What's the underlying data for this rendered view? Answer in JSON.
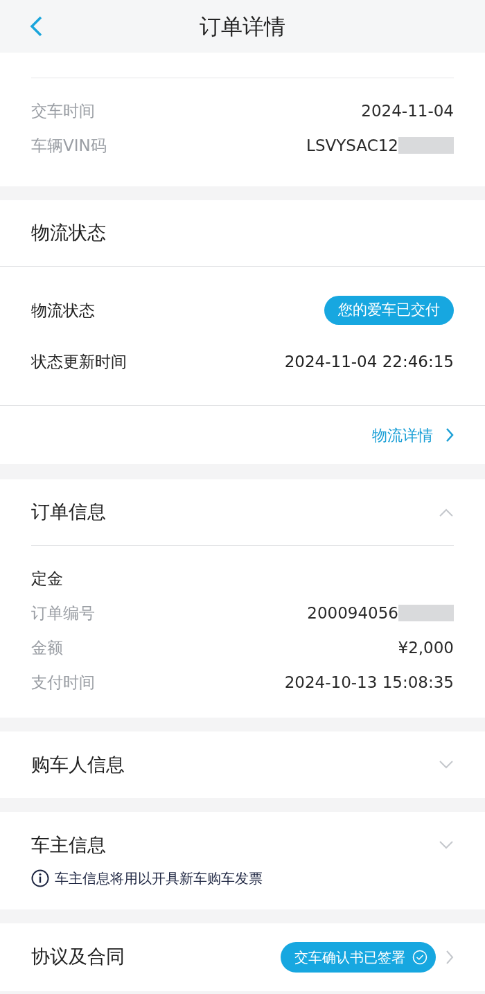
{
  "header": {
    "title": "订单详情"
  },
  "delivery": {
    "rows": [
      {
        "label": "交车时间",
        "value": "2024-11-04",
        "redacted": false
      },
      {
        "label": "车辆VIN码",
        "value": "LSVYSAC12",
        "redacted": true
      }
    ]
  },
  "logistics": {
    "title": "物流状态",
    "status_label": "物流状态",
    "status_badge": "您的爱车已交付",
    "update_label": "状态更新时间",
    "update_value": "2024-11-04 22:46:15",
    "link": "物流详情"
  },
  "order": {
    "title": "订单信息",
    "expanded": true,
    "subtitle": "定金",
    "rows": [
      {
        "label": "订单编号",
        "value": "200094056",
        "redacted": true
      },
      {
        "label": "金额",
        "value": "¥2,000",
        "redacted": false
      },
      {
        "label": "支付时间",
        "value": "2024-10-13 15:08:35",
        "redacted": false
      }
    ]
  },
  "buyer": {
    "title": "购车人信息",
    "expanded": false
  },
  "owner": {
    "title": "车主信息",
    "expanded": false,
    "note": "车主信息将用以开具新车购车发票"
  },
  "contracts": {
    "title": "协议及合同",
    "badge": "交车确认书已签署"
  }
}
